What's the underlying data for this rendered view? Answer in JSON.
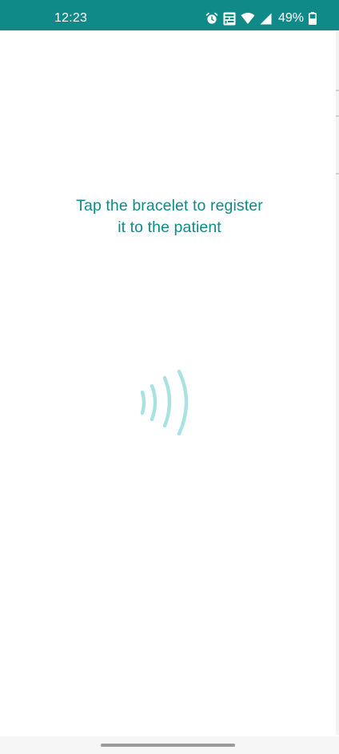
{
  "status_bar": {
    "time": "12:23",
    "battery_percent": "49%",
    "icons": [
      "alarm-icon",
      "volte-icon",
      "wifi-icon",
      "signal-icon",
      "battery-icon"
    ],
    "background_color": "#0f8a88"
  },
  "main": {
    "instruction_line1": "Tap the bracelet to register",
    "instruction_line2": "it to the patient",
    "nfc_icon": "nfc-waves-icon",
    "wave_color": "#a9e3e1"
  }
}
